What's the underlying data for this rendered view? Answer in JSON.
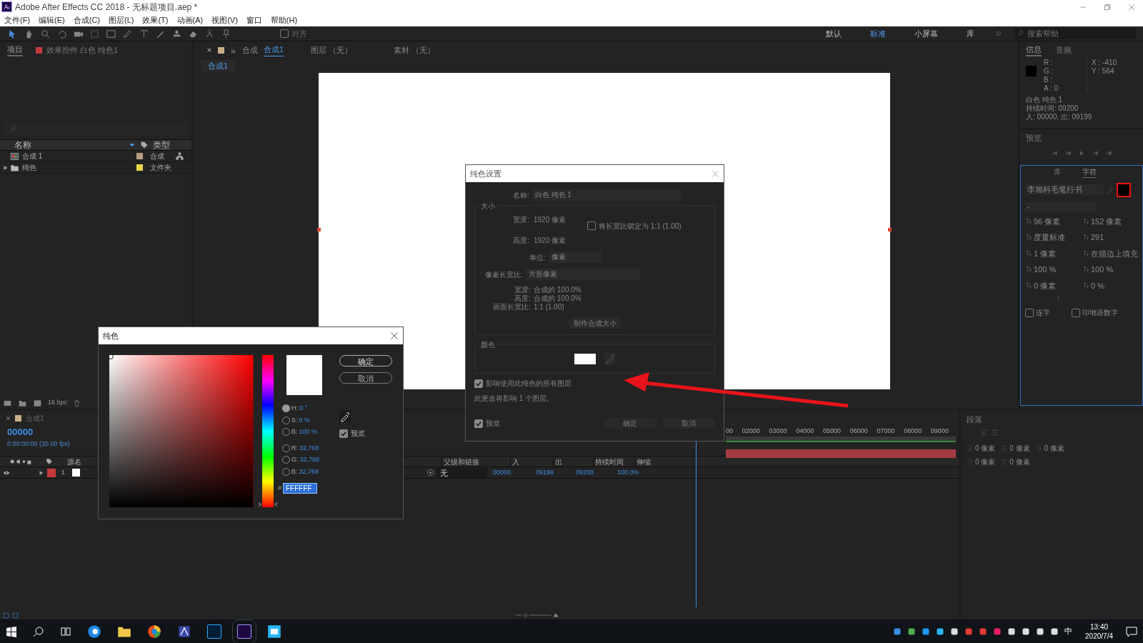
{
  "window": {
    "title": "Adobe After Effects CC 2018 - 无标题项目.aep *"
  },
  "menu": [
    "文件(F)",
    "编辑(E)",
    "合成(C)",
    "图层(L)",
    "效果(T)",
    "动画(A)",
    "视图(V)",
    "窗口",
    "帮助(H)"
  ],
  "toolbar": {
    "align_label": "对齐",
    "align_checked": false
  },
  "workspaces": [
    {
      "label": "默认",
      "selected": false
    },
    {
      "label": "标准",
      "selected": true
    },
    {
      "label": "小屏幕",
      "selected": false
    },
    {
      "label": "库",
      "selected": false
    }
  ],
  "help_search": {
    "placeholder": "搜索帮助"
  },
  "project_panel": {
    "tabs": [
      {
        "label": "项目",
        "selected": true
      },
      {
        "label": "效果控件 白色 纯色1",
        "selected": false
      }
    ],
    "columns": [
      "名称",
      "类型"
    ],
    "items": [
      {
        "name": "合成 1",
        "type": "合成",
        "kind": "comp",
        "color": "#b39f80"
      },
      {
        "name": "纯色",
        "type": "文件夹",
        "kind": "folder",
        "color": "#e8d84a"
      }
    ],
    "bpc": "16 bpc"
  },
  "comp_panel": {
    "tab_prefix": "合成",
    "tab_name": "合成1",
    "other_tabs": [
      "图层 （无）",
      "素材 （无）"
    ],
    "breadcrumb": "合成1"
  },
  "info_panel": {
    "tabs": [
      {
        "label": "信息",
        "selected": true
      },
      {
        "label": "音频",
        "selected": false
      }
    ],
    "channels": [
      "R :",
      "G :",
      "B :",
      "A : 0"
    ],
    "coords": [
      "X : -410",
      "Y : 564"
    ],
    "lines": [
      "白色 纯色 1",
      "持续时间: 09200",
      "入: 00000, 出: 09199"
    ]
  },
  "preview_panel": {
    "title": "预览"
  },
  "character_panel": {
    "tabs": [
      {
        "label": "库",
        "selected": false
      },
      {
        "label": "字符",
        "selected": true
      }
    ],
    "font": "李旭科毛笔行书",
    "style": "-",
    "size": "96 像素",
    "leading": "152 像素",
    "kerning": "度量标准",
    "tracking": "291",
    "stroke": "1 像素",
    "stroke_type": "在描边上填充",
    "vscale": "100 %",
    "hscale": "100 %",
    "baseline": "0 像素",
    "tsume": "0 %",
    "options": [
      {
        "label": "连字",
        "checked": false
      },
      {
        "label": "印地语数字",
        "checked": false
      }
    ]
  },
  "timeline": {
    "tab": "合成1",
    "timecode": "00000",
    "fps": "0:00:00:00 (30.00 fps)",
    "source_col": "源名",
    "columns": [
      "父级和链接",
      "入",
      "出",
      "持续时间",
      "伸缩"
    ],
    "layer": {
      "number": "1",
      "color": "#c4393d",
      "parent": "无",
      "in": "00000",
      "out": "09199",
      "duration": "09200",
      "stretch": "100.0%"
    },
    "ruler": [
      "00",
      "02000",
      "03000",
      "04000",
      "05000",
      "06000",
      "07000",
      "08000",
      "09000"
    ]
  },
  "paragraph_panel": {
    "title": "段落",
    "indents": [
      "0 像素",
      "0 像素",
      "0 像素",
      "0 像素",
      "0 像素"
    ]
  },
  "solid_dialog": {
    "title": "纯色设置",
    "name_label": "名称:",
    "name_value": "白色 纯色 1",
    "size_group": "大小",
    "rows": [
      {
        "label": "宽度:",
        "value": "1920 像素"
      },
      {
        "label": "高度:",
        "value": "1920 像素"
      }
    ],
    "lock": {
      "label": "将长宽比锁定为 1:1 (1.00)",
      "checked": false
    },
    "unit_label": "单位:",
    "unit": "像素",
    "par_label": "像素长宽比:",
    "par": "方形像素",
    "info": [
      {
        "label": "宽度:",
        "value": "合成的 100.0%"
      },
      {
        "label": "高度:",
        "value": "合成的 100.0%"
      },
      {
        "label": "画面长宽比:",
        "value": "1:1 (1.00)"
      }
    ],
    "make_comp_size": "制作合成大小",
    "color_group": "颜色",
    "color": "#ffffff",
    "affect": {
      "label": "影响使用此纯色的所有图层",
      "checked": true
    },
    "note": "此更改将影响 1 个图层。",
    "preview": {
      "label": "预览",
      "checked": true
    },
    "buttons": [
      "确定",
      "取消"
    ]
  },
  "color_dialog": {
    "title": "纯色",
    "buttons": [
      "确定",
      "取消"
    ],
    "preview": {
      "label": "预览",
      "checked": true
    },
    "fields": [
      {
        "label": "H:",
        "value": "0 °",
        "selected": true
      },
      {
        "label": "S:",
        "value": "0 %",
        "selected": false
      },
      {
        "label": "B:",
        "value": "100 %",
        "selected": false
      },
      {
        "label": "R:",
        "value": "32,768",
        "selected": false
      },
      {
        "label": "G:",
        "value": "32,768",
        "selected": false
      },
      {
        "label": "B:",
        "value": "32,768",
        "selected": false
      }
    ],
    "hue_slider": {
      "level": 0
    },
    "hash": "#",
    "hex": "FFFFFF"
  },
  "taskbar": {
    "ime": "中",
    "time": "13:40",
    "date": "2020/7/4"
  }
}
